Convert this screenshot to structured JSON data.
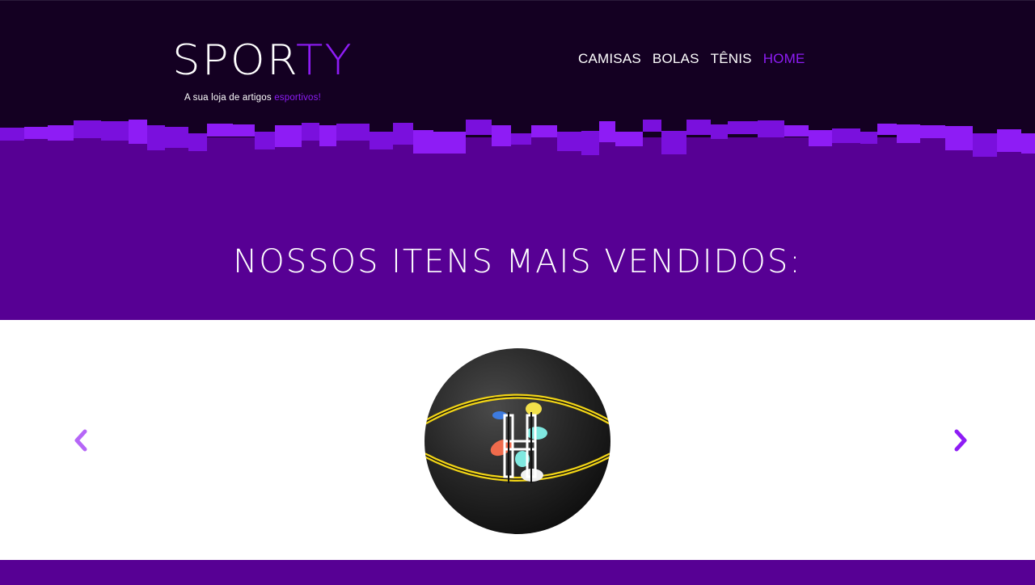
{
  "brand": {
    "logo_part1": "SPOR",
    "logo_part2": "TY",
    "tagline_prefix": "A sua loja de artigos",
    "tagline_accent": "esportivos!"
  },
  "nav": {
    "items": [
      {
        "label": "CAMISAS",
        "active": false
      },
      {
        "label": "BOLAS",
        "active": false
      },
      {
        "label": "TÊNIS",
        "active": false
      },
      {
        "label": "HOME",
        "active": true
      }
    ]
  },
  "hero": {
    "title": "NOSSOS ITENS MAIS VENDIDOS:"
  },
  "carousel": {
    "prev_icon": "chevron-left-icon",
    "next_icon": "chevron-right-icon",
    "current_item_image": "basketball-image"
  },
  "colors": {
    "header_bg": "#140022",
    "hero_bg": "#570094",
    "accent": "#8e1cf5",
    "arrow_light": "#b566f7"
  }
}
